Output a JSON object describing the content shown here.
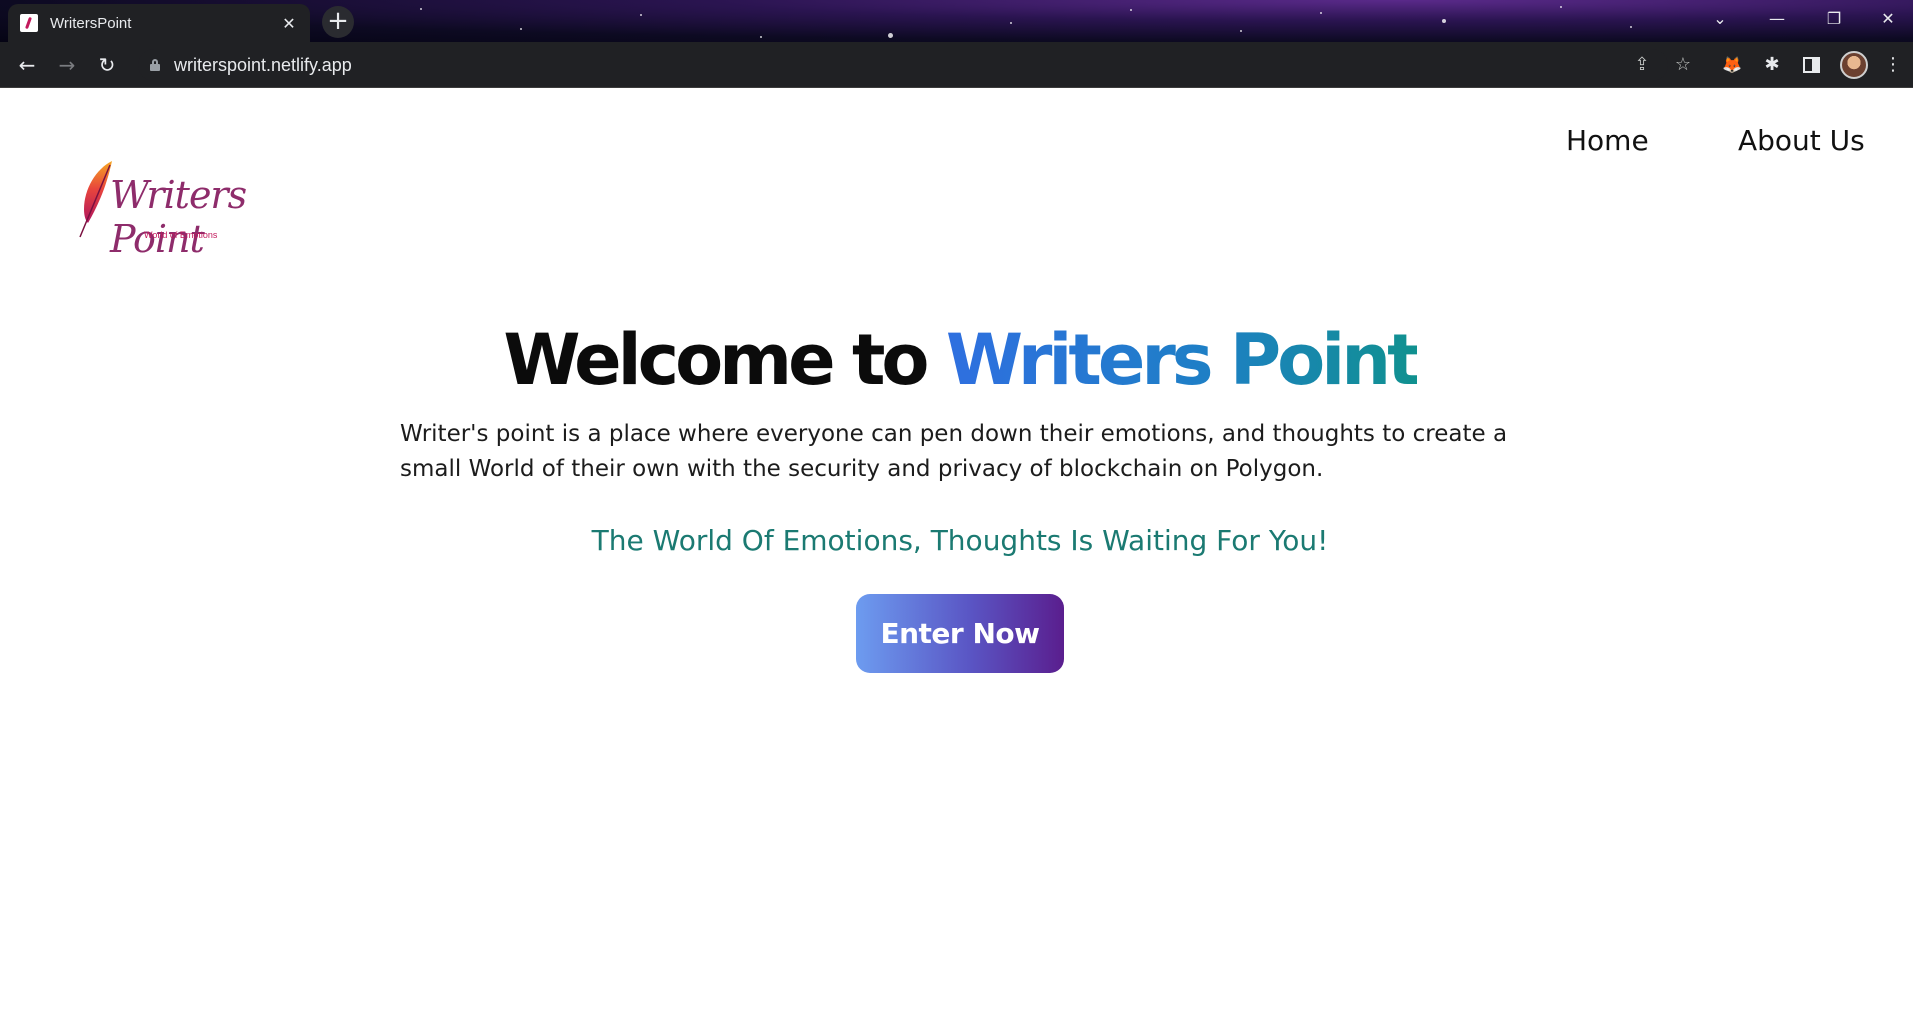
{
  "browser": {
    "tab_title": "WritersPoint",
    "tab_close": "✕",
    "new_tab": "+",
    "url": "writerspoint.netlify.app",
    "window_controls": {
      "tab_search": "⌄",
      "minimize": "—",
      "restore": "❐",
      "close": "✕"
    },
    "nav": {
      "back": "←",
      "forward": "→",
      "reload": "↻"
    },
    "toolbar_icons": [
      "share-icon",
      "bookmark-star-icon",
      "metamask-fox-icon",
      "extensions-puzzle-icon",
      "side-panel-icon",
      "profile-avatar",
      "menu-dots-icon"
    ],
    "toolbar_glyphs": {
      "share": "⇪",
      "star": "☆",
      "fox": "🦊",
      "puzzle": "✱",
      "menu": "⋮"
    }
  },
  "site": {
    "logo": {
      "text": "Writers Point",
      "subtitle": "World of Emotions"
    },
    "nav": {
      "home": "Home",
      "about": "About Us"
    },
    "hero": {
      "title_prefix": "Welcome to ",
      "title_accent": "Writers Point",
      "description": "Writer's point is a place where everyone can pen down their emotions, and thoughts to create a small World of their own with the security and privacy of blockchain on Polygon.",
      "tagline": "The World Of Emotions, Thoughts Is Waiting For You!",
      "cta": "Enter Now"
    }
  },
  "colors": {
    "accent_gradient_start": "#2f6fe0",
    "accent_gradient_end": "#10918f",
    "tagline": "#1b7a72",
    "button_gradient_start": "#6d9cf0",
    "button_gradient_end": "#5a1e8e",
    "logo": "#8e2c6b"
  }
}
